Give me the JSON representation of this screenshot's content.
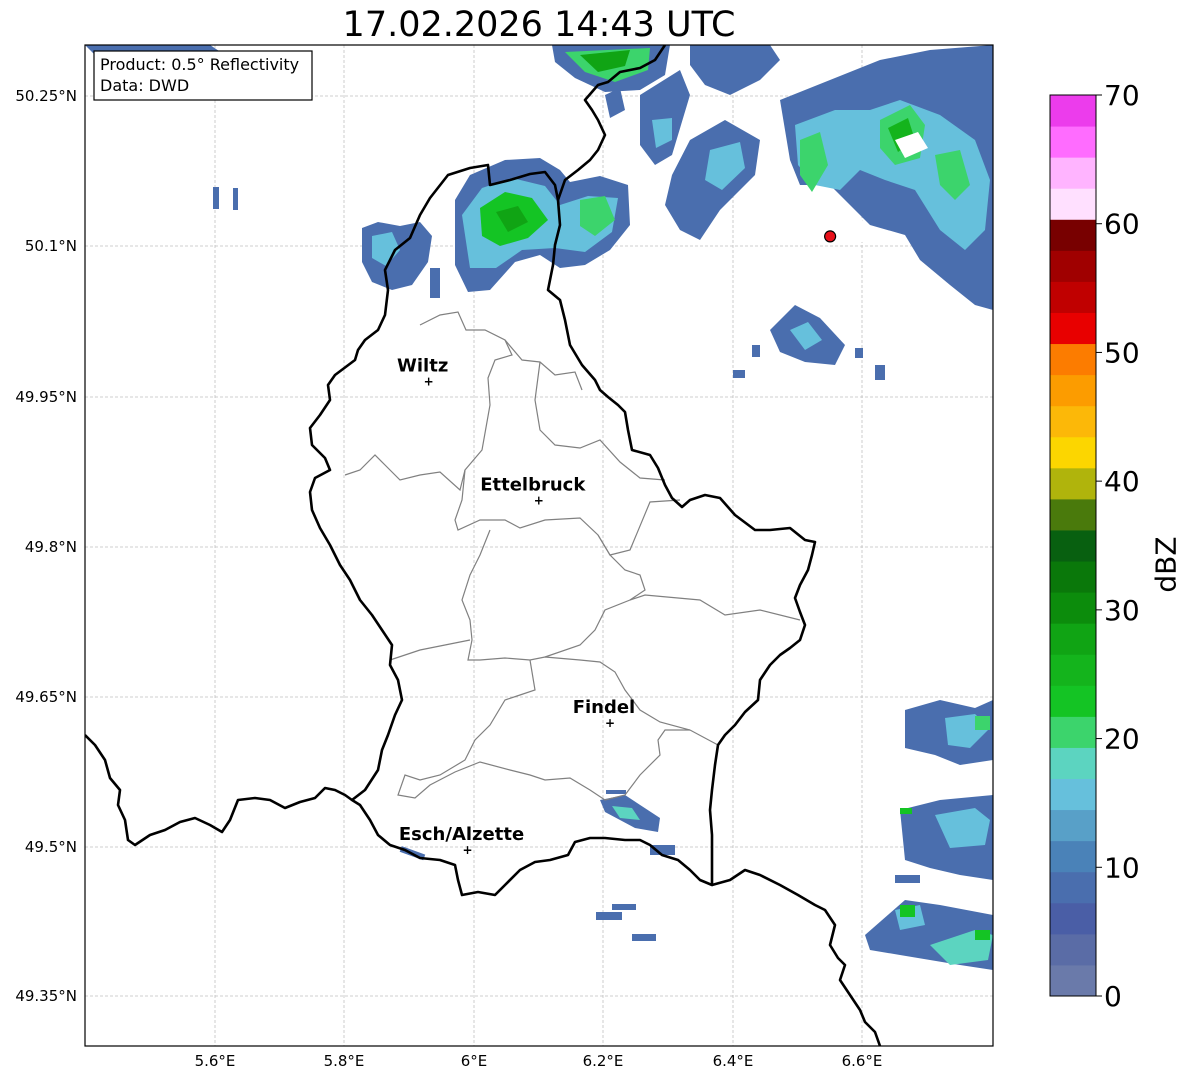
{
  "title": "17.02.2026 14:43 UTC",
  "info_box": {
    "line1": "Product: 0.5° Reflectivity",
    "line2": "Data: DWD"
  },
  "latitude_ticks": [
    "50.25°N",
    "50.1°N",
    "49.95°N",
    "49.8°N",
    "49.65°N",
    "49.5°N",
    "49.35°N"
  ],
  "longitude_ticks": [
    "5.6°E",
    "5.8°E",
    "6°E",
    "6.2°E",
    "6.4°E",
    "6.6°E"
  ],
  "cities": [
    {
      "name": "Wiltz",
      "lon": 5.93,
      "lat": 49.965
    },
    {
      "name": "Ettelbruck",
      "lon": 6.1,
      "lat": 49.846
    },
    {
      "name": "Findel",
      "lon": 6.21,
      "lat": 49.624
    },
    {
      "name": "Esch/Alzette",
      "lon": 5.99,
      "lat": 49.497
    }
  ],
  "radar_site": {
    "lon": 6.55,
    "lat": 50.11,
    "color": "#e8101a"
  },
  "colorbar": {
    "label": "dBZ",
    "ticks": [
      "0",
      "10",
      "20",
      "30",
      "40",
      "50",
      "60",
      "70"
    ],
    "colors": [
      "#6a7aaa",
      "#5a6ca6",
      "#4a5ea6",
      "#4a6eae",
      "#4a82b8",
      "#58a0c8",
      "#66c0dc",
      "#5cd4c0",
      "#3cd46c",
      "#14c424",
      "#14b41c",
      "#10a414",
      "#0c8c0c",
      "#0a780a",
      "#086010",
      "#4a7a0c",
      "#b0b40c",
      "#fcd600",
      "#fcb808",
      "#fc9c00",
      "#fc7c00",
      "#e80000",
      "#c00000",
      "#a00000",
      "#780000",
      "#ffe0ff",
      "#ffb4ff",
      "#ff6cff",
      "#ec3cec"
    ]
  }
}
